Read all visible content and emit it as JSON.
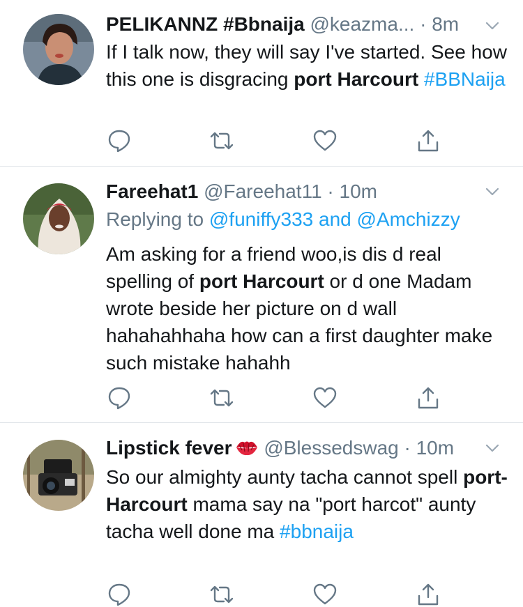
{
  "tweets": [
    {
      "name": "PELIKANNZ #Bbnaija",
      "handle": "@keazma...",
      "sep": "·",
      "time": "8m",
      "text_parts": [
        "If I talk now, they will say I've started. See how this one is disgracing ",
        "port Harcourt",
        " ",
        "#BBNaija"
      ],
      "avatar_icon": "profile-photo-woman-selfie"
    },
    {
      "name": "Fareehat1",
      "handle": "@Fareehat11",
      "sep": "·",
      "time": "10m",
      "reply_prefix": "Replying to ",
      "reply_user1": "@funiffy333",
      "reply_and": " and ",
      "reply_user2": "@Amchizzy",
      "text_parts": [
        "Am asking for a friend woo,is dis d real spelling of ",
        "port Harcourt",
        " or d one Madam wrote beside her picture on d wall hahahahhaha how can a first daughter make such mistake hahahh"
      ],
      "avatar_icon": "profile-photo-woman-hijab"
    },
    {
      "name": "Lipstick fever",
      "name_emoji": "lips-kiss-emoji",
      "handle": "@Blessedswag",
      "sep": "·",
      "time": "10m",
      "text_parts": [
        "So our almighty aunty tacha cannot spell ",
        "port- Harcourt",
        " mama say na \"port harcot\" aunty tacha well done ma ",
        "#bbnaija"
      ],
      "avatar_icon": "profile-photo-camera"
    }
  ],
  "icons": {
    "reply": "reply-bubble-icon",
    "retweet": "retweet-icon",
    "like": "heart-icon",
    "share": "share-icon",
    "menu": "chevron-down-icon"
  },
  "colors": {
    "text": "#14171a",
    "secondary": "#657786",
    "link": "#1da1f2",
    "divider": "#dfe3e8"
  }
}
